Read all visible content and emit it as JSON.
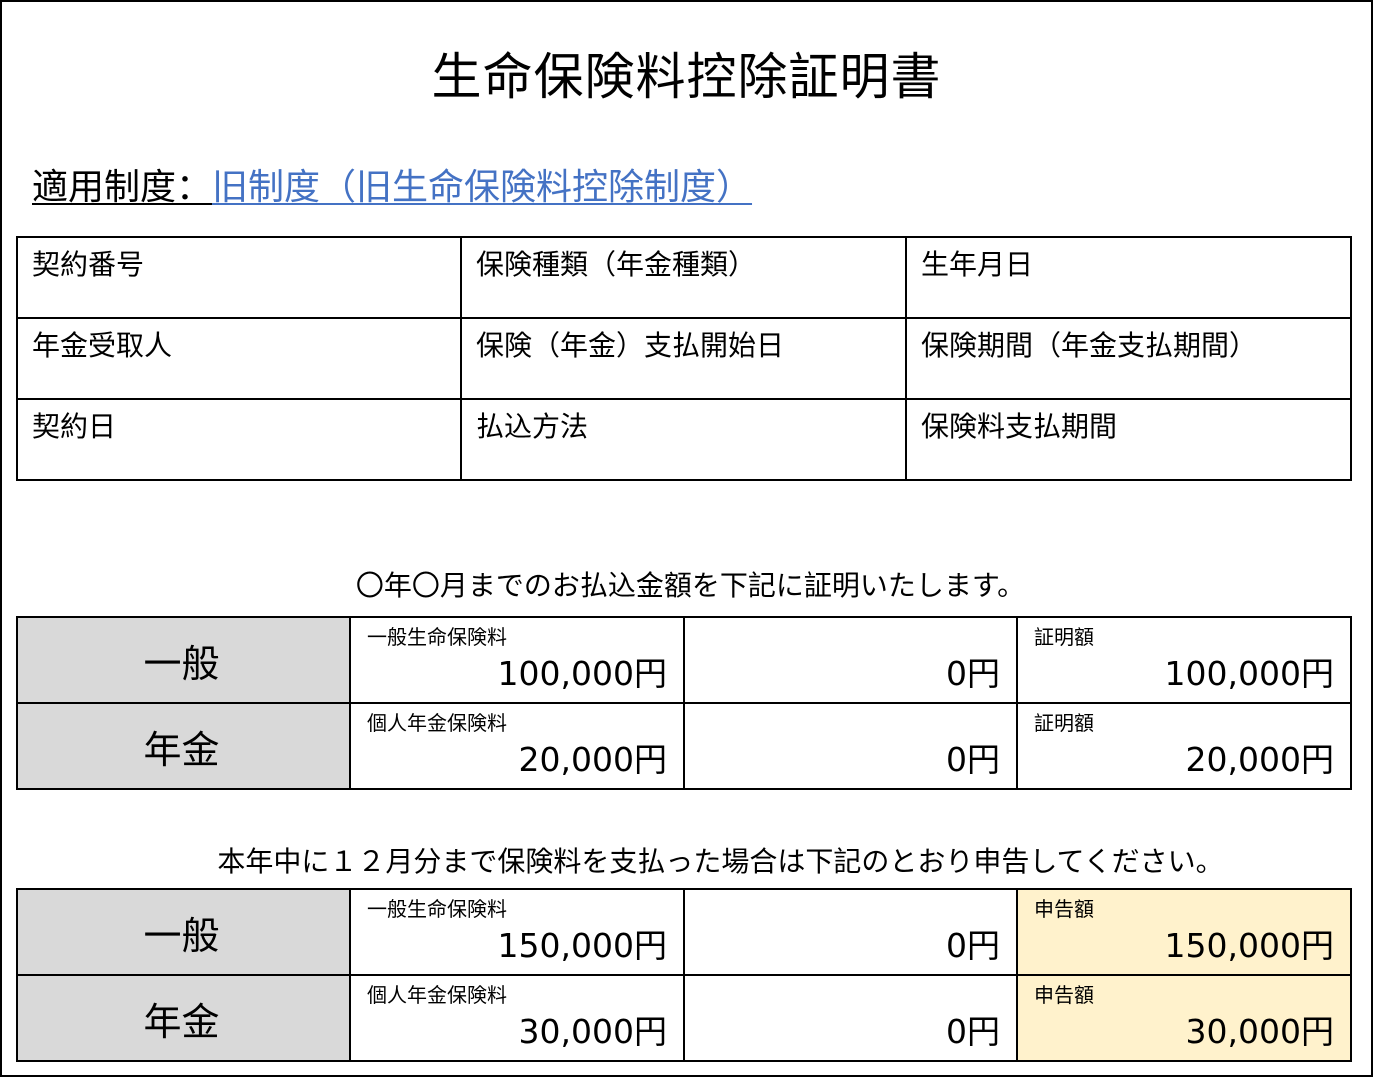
{
  "title": "生命保険料控除証明書",
  "system": {
    "label": "適用制度：",
    "value": "旧制度（旧生命保険料控除制度）"
  },
  "info_table": {
    "rows": [
      [
        "契約番号",
        "保険種類（年金種類）",
        "生年月日"
      ],
      [
        "年金受取人",
        "保険（年金）支払開始日",
        "保険期間（年金支払期間）"
      ],
      [
        "契約日",
        "払込方法",
        "保険料支払期間"
      ]
    ]
  },
  "certified": {
    "note": "〇年〇月までのお払込金額を下記に証明いたします。",
    "rows": [
      {
        "category": "一般",
        "premium_label": "一般生命保険料",
        "premium_value": "100,000円",
        "other_value": "0円",
        "result_label": "証明額",
        "result_value": "100,000円"
      },
      {
        "category": "年金",
        "premium_label": "個人年金保険料",
        "premium_value": "20,000円",
        "other_value": "0円",
        "result_label": "証明額",
        "result_value": "20,000円"
      }
    ]
  },
  "declaration": {
    "note": "本年中に１２月分まで保険料を支払った場合は下記のとおり申告してください。",
    "highlight_color": "#fff2cc",
    "rows": [
      {
        "category": "一般",
        "premium_label": "一般生命保険料",
        "premium_value": "150,000円",
        "other_value": "0円",
        "result_label": "申告額",
        "result_value": "150,000円"
      },
      {
        "category": "年金",
        "premium_label": "個人年金保険料",
        "premium_value": "30,000円",
        "other_value": "0円",
        "result_label": "申告額",
        "result_value": "30,000円"
      }
    ]
  },
  "colors": {
    "category_bg": "#d9d9d9",
    "link": "#4472c4"
  }
}
